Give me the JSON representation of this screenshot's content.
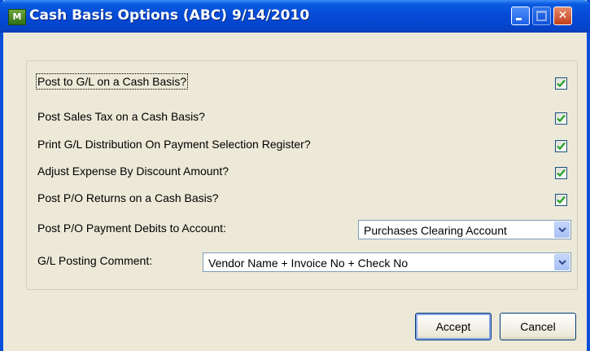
{
  "window": {
    "title": "Cash Basis Options (ABC) 9/14/2010",
    "app_icon_text": "M"
  },
  "options": [
    {
      "label": "Post to G/L on a Cash Basis?",
      "checked": true
    },
    {
      "label": "Post Sales Tax on a Cash Basis?",
      "checked": true
    },
    {
      "label": "Print G/L Distribution On Payment Selection Register?",
      "checked": true
    },
    {
      "label": "Adjust Expense By Discount Amount?",
      "checked": true
    },
    {
      "label": "Post P/O Returns on a Cash Basis?",
      "checked": true
    }
  ],
  "debits_account": {
    "label": "Post P/O Payment Debits to Account:",
    "value": "Purchases Clearing Account"
  },
  "posting_comment": {
    "label": "G/L Posting Comment:",
    "value": "Vendor Name + Invoice No + Check No"
  },
  "buttons": {
    "accept": "Accept",
    "cancel": "Cancel"
  },
  "icons": {
    "minimize": "minimize-icon",
    "maximize": "maximize-icon",
    "close": "close-icon",
    "check": "check-icon",
    "dropdown": "chevron-down-icon"
  },
  "colors": {
    "titlebar": "#0549d6",
    "check": "#21a121",
    "face": "#ece9d8"
  }
}
